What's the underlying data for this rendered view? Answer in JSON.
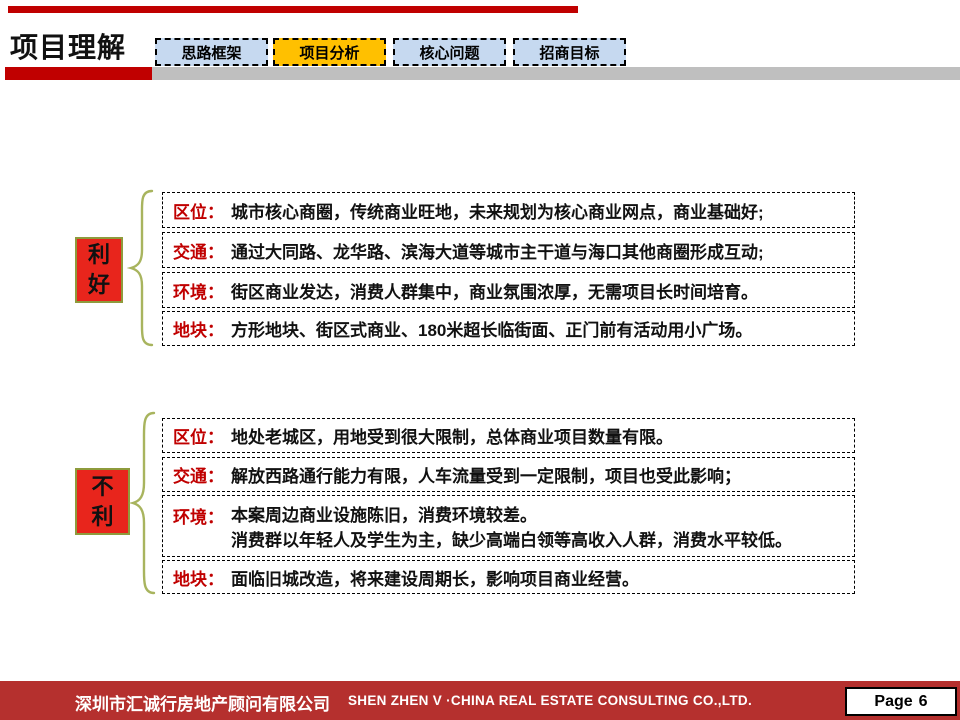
{
  "header": {
    "title": "项目理解",
    "tabs": [
      {
        "label": "思路框架",
        "active": false
      },
      {
        "label": "项目分析",
        "active": true
      },
      {
        "label": "核心问题",
        "active": false
      },
      {
        "label": "招商目标",
        "active": false
      }
    ]
  },
  "colors": {
    "accent_red": "#C00000",
    "label_box_red": "#E8251C",
    "label_box_border_olive": "#8E9B3C",
    "brace_olive": "#A8B45E",
    "tab_blue": "#C6D9F0",
    "tab_active_yellow": "#FFC000",
    "header_gray": "#BFBFBF",
    "footer_red": "#B5302E"
  },
  "groups": [
    {
      "side_label": "利好",
      "rows": [
        {
          "label": "区位：",
          "text": "城市核心商圈，传统商业旺地，未来规划为核心商业网点，商业基础好;"
        },
        {
          "label": "交通：",
          "text": "通过大同路、龙华路、滨海大道等城市主干道与海口其他商圈形成互动;"
        },
        {
          "label": "环境：",
          "text": "街区商业发达，消费人群集中，商业氛围浓厚，无需项目长时间培育。"
        },
        {
          "label": "地块：",
          "text": "方形地块、街区式商业、180米超长临街面、正门前有活动用小广场。"
        }
      ]
    },
    {
      "side_label": "不利",
      "rows": [
        {
          "label": "区位：",
          "text": "地处老城区，用地受到很大限制，总体商业项目数量有限。"
        },
        {
          "label": "交通：",
          "text": "解放西路通行能力有限，人车流量受到一定限制，项目也受此影响；"
        },
        {
          "label": "环境：",
          "text": "本案周边商业设施陈旧，消费环境较差。",
          "text2": "消费群以年轻人及学生为主，缺少高端白领等高收入人群，消费水平较低。"
        },
        {
          "label": "地块：",
          "text": "面临旧城改造，将来建设周期长，影响项目商业经营。"
        }
      ]
    }
  ],
  "footer": {
    "company_cn": "深圳市汇诚行房地产顾问有限公司",
    "company_en": "SHEN ZHEN V ·CHINA REAL ESTATE CONSULTING CO.,LTD.",
    "page_label": "Page",
    "page_number": "6"
  }
}
